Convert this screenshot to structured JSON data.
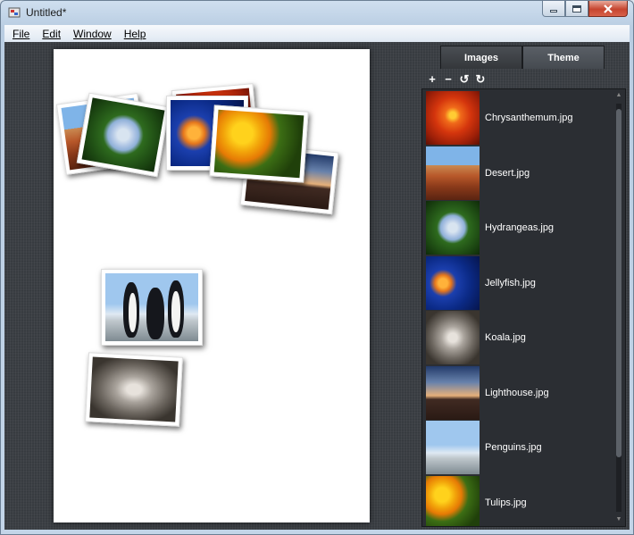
{
  "window": {
    "title": "Untitled*"
  },
  "menu": [
    "File",
    "Edit",
    "Window",
    "Help"
  ],
  "tabs": {
    "images": "Images",
    "theme": "Theme"
  },
  "toolbar": {
    "add": "+",
    "remove": "−",
    "rotate_left": "↺",
    "rotate_right": "↻"
  },
  "images": [
    {
      "label": "Chrysanthemum.jpg",
      "icon": "chrysanthemum-thumb"
    },
    {
      "label": "Desert.jpg",
      "icon": "desert-thumb"
    },
    {
      "label": "Hydrangeas.jpg",
      "icon": "hydrangeas-thumb"
    },
    {
      "label": "Jellyfish.jpg",
      "icon": "jellyfish-thumb"
    },
    {
      "label": "Koala.jpg",
      "icon": "koala-thumb"
    },
    {
      "label": "Lighthouse.jpg",
      "icon": "lighthouse-thumb"
    },
    {
      "label": "Penguins.jpg",
      "icon": "penguins-thumb"
    },
    {
      "label": "Tulips.jpg",
      "icon": "tulips-thumb"
    }
  ],
  "colors": {
    "panel_bg": "#2b2e33",
    "canvas_bg": "#3b3f44",
    "page_bg": "#ffffff"
  }
}
